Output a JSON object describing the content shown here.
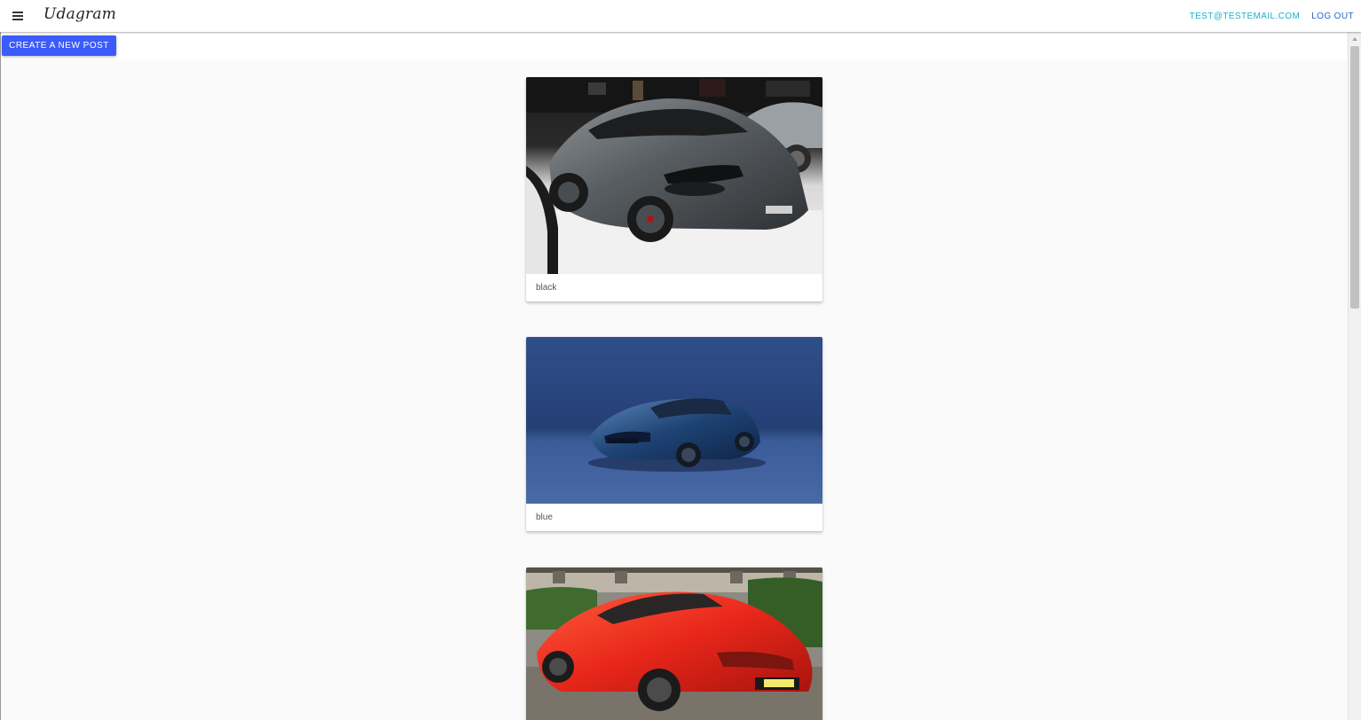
{
  "app": {
    "brand": "Udagram"
  },
  "nav": {
    "email": "TEST@TESTEMAIL.COM",
    "logout": "LOG OUT"
  },
  "actions": {
    "create_post": "CREATE A NEW POST"
  },
  "posts": [
    {
      "caption": "black"
    },
    {
      "caption": "blue"
    },
    {
      "caption": ""
    }
  ],
  "colors": {
    "primary_button": "#3c5bfc",
    "email_link": "#16b3c9",
    "logout_link": "#2a66c5",
    "page_background": "#fafafa"
  },
  "icons": {
    "menu": "menu-icon"
  }
}
